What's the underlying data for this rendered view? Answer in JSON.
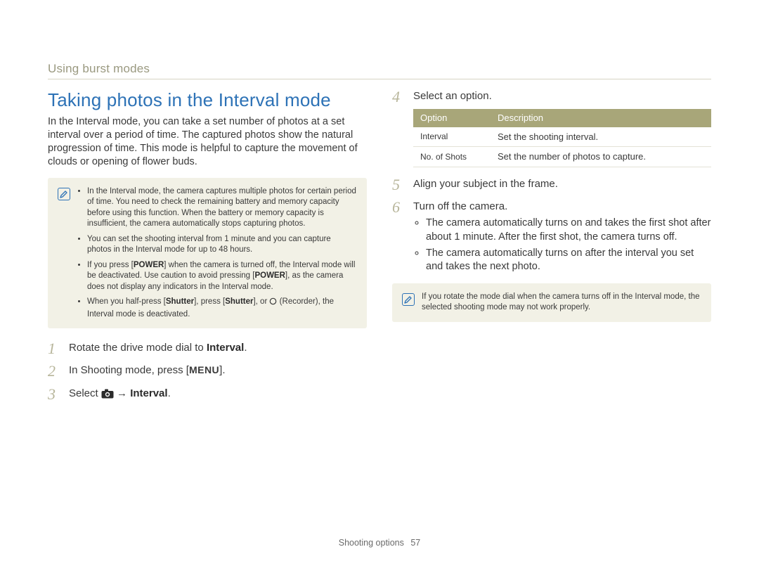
{
  "section_label": "Using burst modes",
  "left": {
    "title": "Taking photos in the Interval mode",
    "intro": "In the Interval mode, you can take a set number of photos at a set interval over a period of time. The captured photos show the natural progression of time. This mode is helpful to capture the movement of clouds or opening of flower buds.",
    "notes": {
      "n1_a": "In the Interval mode, the camera captures multiple photos for certain period of time. You need to check the remaining battery and memory capacity before using this function. When the battery or memory capacity is insufficient, the camera automatically stops capturing photos.",
      "n2_a": "You can set the shooting interval from 1 minute and you can capture photos in the Interval mode for up to 48 hours.",
      "n3_a": "If you press [",
      "n3_b": "POWER",
      "n3_c": "] when the camera is turned off, the Interval mode will be deactivated. Use caution to avoid pressing [",
      "n3_d": "POWER",
      "n3_e": "], as the camera does not display any indicators in the Interval mode.",
      "n4_a": "When you half-press [",
      "n4_b": "Shutter",
      "n4_c": "], press [",
      "n4_d": "Shutter",
      "n4_e": "], or ",
      "n4_f": " (Recorder), the Interval mode is deactivated."
    },
    "steps": {
      "s1_a": "Rotate the drive mode dial to ",
      "s1_b": "Interval",
      "s1_c": ".",
      "s2_a": "In Shooting mode, press [",
      "s2_b": "MENU",
      "s2_c": "].",
      "s3_a": "Select ",
      "s3_b": " → ",
      "s3_c": "Interval",
      "s3_d": "."
    }
  },
  "right": {
    "steps": {
      "s4": "Select an option.",
      "s5": "Align your subject in the frame.",
      "s6": "Turn off the camera."
    },
    "table": {
      "h1": "Option",
      "h2": "Description",
      "r1c1": "Interval",
      "r1c2": "Set the shooting interval.",
      "r2c1": "No. of Shots",
      "r2c2": "Set the number of photos to capture."
    },
    "sub6": {
      "b1": "The camera automatically turns on and takes the first shot after about 1 minute. After the first shot, the camera turns off.",
      "b2": "The camera automatically turns on after the interval you set and takes the next photo."
    },
    "note": "If you rotate the mode dial when the camera turns off in the Interval mode, the selected shooting mode may not work properly."
  },
  "footer": {
    "section": "Shooting options",
    "page": "57"
  },
  "nums": {
    "n1": "1",
    "n2": "2",
    "n3": "3",
    "n4": "4",
    "n5": "5",
    "n6": "6"
  }
}
